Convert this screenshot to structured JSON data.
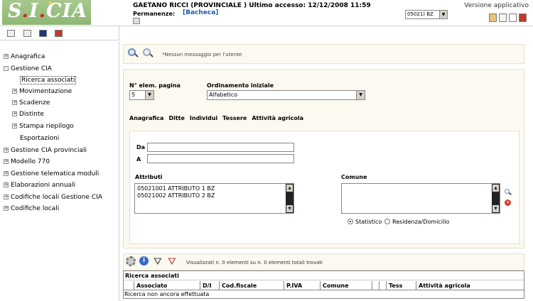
{
  "header": {
    "logo_text": "S.I.CIA",
    "user_line": "GAETANO RICCI (PROVINCIALE ) Ultimo accesso: 12/12/2008 11:59",
    "permanenze_label": "Permanenze:",
    "permanenze_value": "[Bacheca]",
    "province_select": "05021) BZ",
    "version": "Versione applicativo",
    "icons": [
      "book-icon",
      "document-icon",
      "mail-icon",
      "exit-icon"
    ]
  },
  "left_toolbar": [
    "expand-all-icon",
    "collapse-all-icon",
    "bookmark-icon",
    "print-icon"
  ],
  "sidebar": {
    "items": [
      {
        "label": "Anagrafica",
        "level": 0,
        "expander": "+"
      },
      {
        "label": "Gestione CIA",
        "level": 0,
        "expander": "-"
      },
      {
        "label": "Ricerca associati",
        "level": 1,
        "expander": "",
        "selected": true
      },
      {
        "label": "Movimentazione",
        "level": 1,
        "expander": "+"
      },
      {
        "label": "Scadenze",
        "level": 1,
        "expander": "+"
      },
      {
        "label": "Distinte",
        "level": 1,
        "expander": "+"
      },
      {
        "label": "Stampa riepilogo",
        "level": 1,
        "expander": "+"
      },
      {
        "label": "Esportazioni",
        "level": 1,
        "expander": ""
      },
      {
        "label": "Gestione CIA provinciali",
        "level": 0,
        "expander": "+"
      },
      {
        "label": "Modello 770",
        "level": 0,
        "expander": "+"
      },
      {
        "label": "Gestione telematica moduli",
        "level": 0,
        "expander": "+"
      },
      {
        "label": "Elaborazioni annuali",
        "level": 0,
        "expander": "+"
      },
      {
        "label": "Codifiche locali Gestione CIA",
        "level": 0,
        "expander": "+"
      },
      {
        "label": "Codifiche locali",
        "level": 0,
        "expander": "+"
      }
    ]
  },
  "messages": {
    "text": "*Nessun messaggio per l'utente"
  },
  "filter": {
    "page_size_label": "N° elem. pagina",
    "page_size_value": "5",
    "order_label": "Ordinamento iniziale",
    "order_value": "Alfabetico",
    "tabs": [
      "Anagrafica",
      "Ditte",
      "Individui",
      "Tessere",
      "Attività agricola"
    ],
    "da_label": "Da",
    "a_label": "A",
    "attributi_label": "Attributi",
    "attributi": [
      "05021001 ATTRIBUTO 1 BZ",
      "05021002 ATTRIBUTO 2 BZ"
    ],
    "comune_label": "Comune",
    "radio_statistico": "Statistico",
    "radio_residenza": "Residenza/Domicilio"
  },
  "results": {
    "status": "Visualizzati n. 0 elementi su n. 0 elementi totali trovati",
    "title": "Ricerca associati",
    "columns": [
      "Associato",
      "D/I",
      "Cod.fiscale",
      "P.IVA",
      "Comune",
      "",
      "",
      "Tess",
      "Attività agricola"
    ],
    "empty_text": "Ricerca non ancora effettuata"
  },
  "colors": {
    "logo_green": "#8fb773",
    "panel_bg": "#fbf9f0",
    "link_blue": "#1f5aa6"
  }
}
